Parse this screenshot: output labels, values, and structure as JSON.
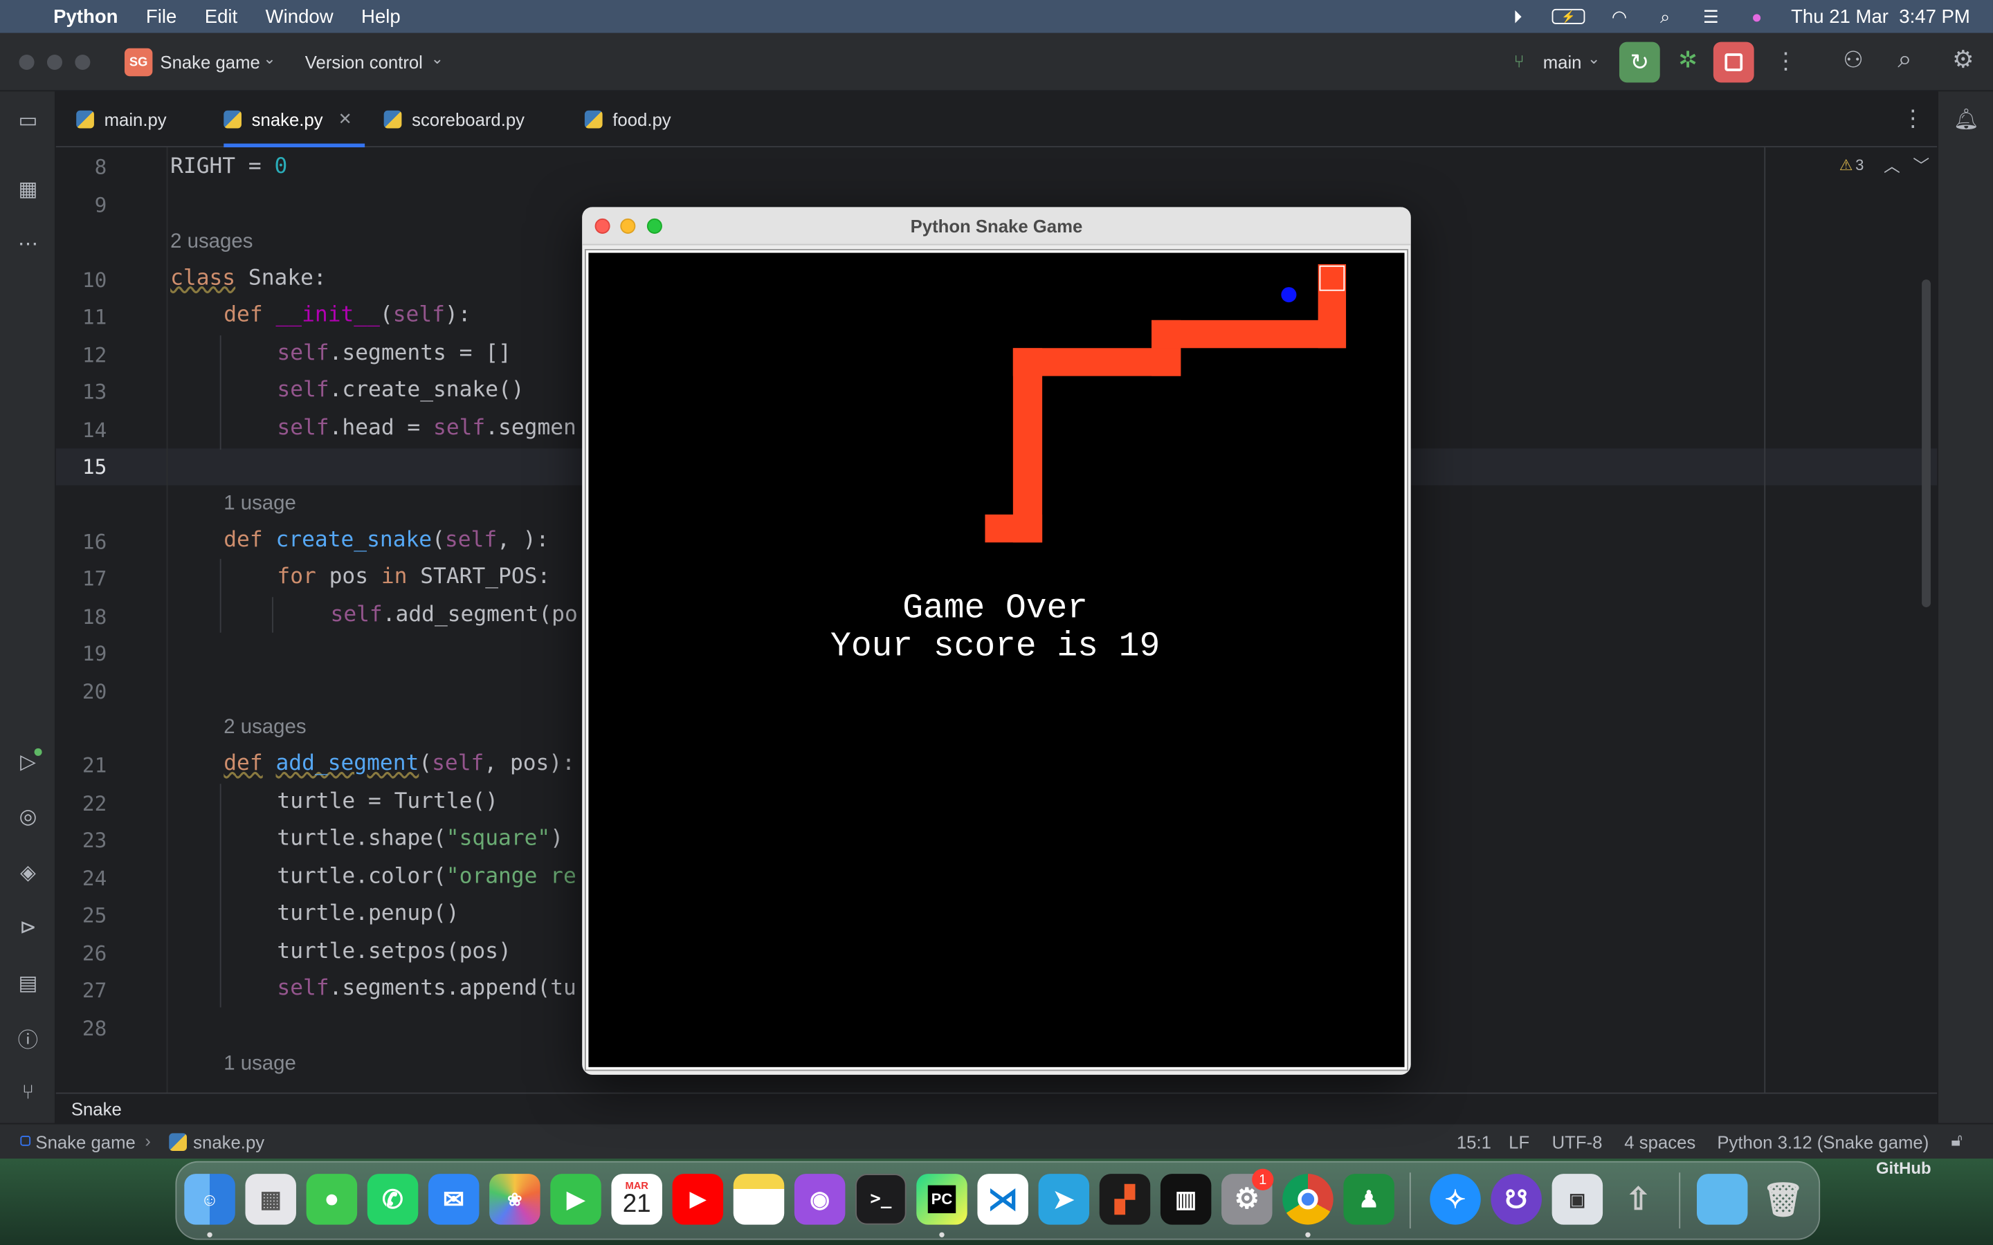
{
  "menubar": {
    "app": "Python",
    "items": [
      "File",
      "Edit",
      "Window",
      "Help"
    ],
    "clock": "Thu 21 Mar  3:47 PM"
  },
  "titlebar": {
    "project_badge": "SG",
    "project_name": "Snake game",
    "vcs": "Version control",
    "branch": "main"
  },
  "tabs": [
    {
      "label": "main.py"
    },
    {
      "label": "snake.py",
      "active": true
    },
    {
      "label": "scoreboard.py"
    },
    {
      "label": "food.py"
    }
  ],
  "editor": {
    "warnings": "3",
    "hints": {
      "usages2a": "2 usages",
      "usage1a": "1 usage",
      "usages2b": "2 usages",
      "usage1b": "1 usage"
    },
    "line_numbers": [
      "8",
      "9",
      "10",
      "11",
      "12",
      "13",
      "14",
      "15",
      "16",
      "17",
      "18",
      "19",
      "20",
      "21",
      "22",
      "23",
      "24",
      "25",
      "26",
      "27",
      "28"
    ]
  },
  "breadcrumb": {
    "symbol": "Snake"
  },
  "statusbar": {
    "project": "Snake game",
    "file": "snake.py",
    "position": "15:1",
    "line_sep": "LF",
    "encoding": "UTF-8",
    "indent": "4 spaces",
    "interpreter": "Python 3.12 (Snake game)"
  },
  "game_window": {
    "title": "Python Snake Game",
    "line1": "Game Over",
    "line2": "Your score is 19"
  },
  "dock": {
    "calendar_month": "MAR",
    "calendar_day": "21",
    "settings_badge": "1",
    "pycharm_label": "PC",
    "corner_label": "GitHub"
  },
  "colors": {
    "snake": "#ff4520",
    "food": "#0a14ff",
    "accent": "#3574f0"
  }
}
